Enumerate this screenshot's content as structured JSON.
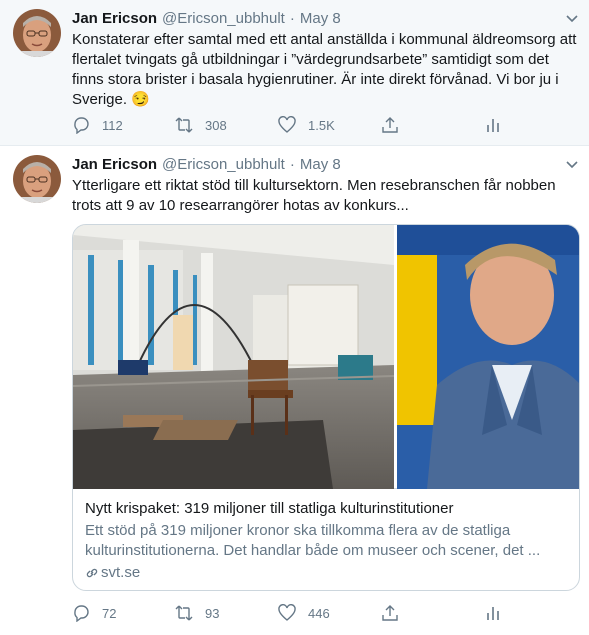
{
  "tweets": [
    {
      "author_name": "Jan Ericson",
      "handle": "@Ericson_ubbhult",
      "separator": "·",
      "date": "May 8",
      "text": "Konstaterar efter samtal med ett antal anställda i kommunal äldreomsorg att flertalet tvingats gå utbildningar i ”värdegrundsarbete” samtidigt som det finns stora brister i basala hygienrutiner. Är inte direkt förvånad. Vi bor ju i Sverige. 😏",
      "reply_count": "112",
      "retweet_count": "308",
      "like_count": "1.5K"
    },
    {
      "author_name": "Jan Ericson",
      "handle": "@Ericson_ubbhult",
      "separator": "·",
      "date": "May 8",
      "text": "Ytterligare ett riktat stöd till kultursektorn. Men resebranschen får nobben trots att 9 av 10 researrangörer hotas av konkurs...",
      "card": {
        "title": "Nytt krispaket: 319 miljoner till statliga kulturinstitutioner",
        "description": "Ett stöd på 319 miljoner kronor ska tillkomma flera av de statliga kulturinstitutionerna. Det handlar både om museer och scener, det ...",
        "domain": "svt.se"
      },
      "reply_count": "72",
      "retweet_count": "93",
      "like_count": "446"
    }
  ],
  "colors": {
    "text_primary": "#14171a",
    "text_secondary": "#657786",
    "border": "#e6ecf0",
    "hover_bg": "#f5f8fa"
  }
}
